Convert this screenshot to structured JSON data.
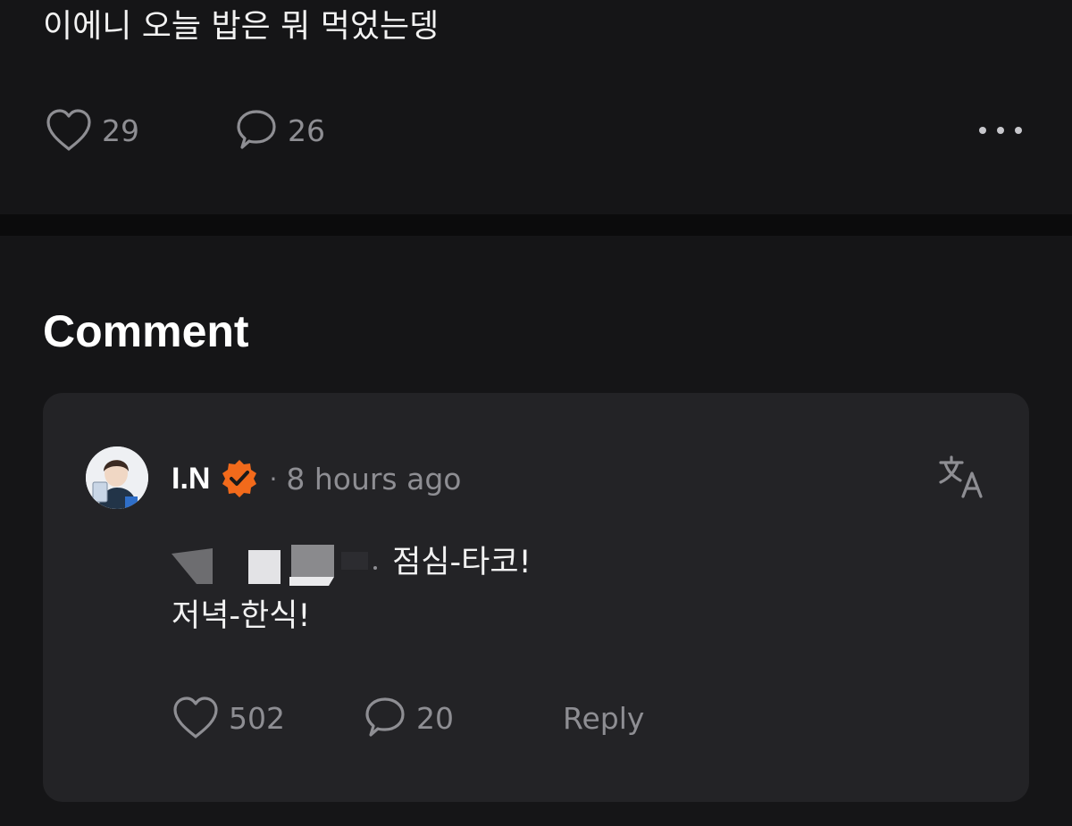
{
  "post": {
    "text": "이에니 오늘 밥은 뭐 먹었는뎅",
    "likes": "29",
    "comments": "26"
  },
  "section": {
    "title": "Comment"
  },
  "comment": {
    "author": "I.N",
    "separator": "·",
    "timestamp": "8 hours ago",
    "line1": "점심-타코!",
    "line2": "저녁-한식!",
    "likes": "502",
    "replies": "20",
    "reply_label": "Reply"
  },
  "colors": {
    "background": "#151517",
    "card": "#232326",
    "text_primary": "#f2f2f2",
    "text_muted": "#8e8e93",
    "verified_badge": "#f26a1b"
  },
  "icons": {
    "like": "heart-outline-icon",
    "comment": "speech-bubble-icon",
    "more": "more-horizontal-icon",
    "verified": "verified-badge-icon",
    "translate": "translate-icon"
  }
}
